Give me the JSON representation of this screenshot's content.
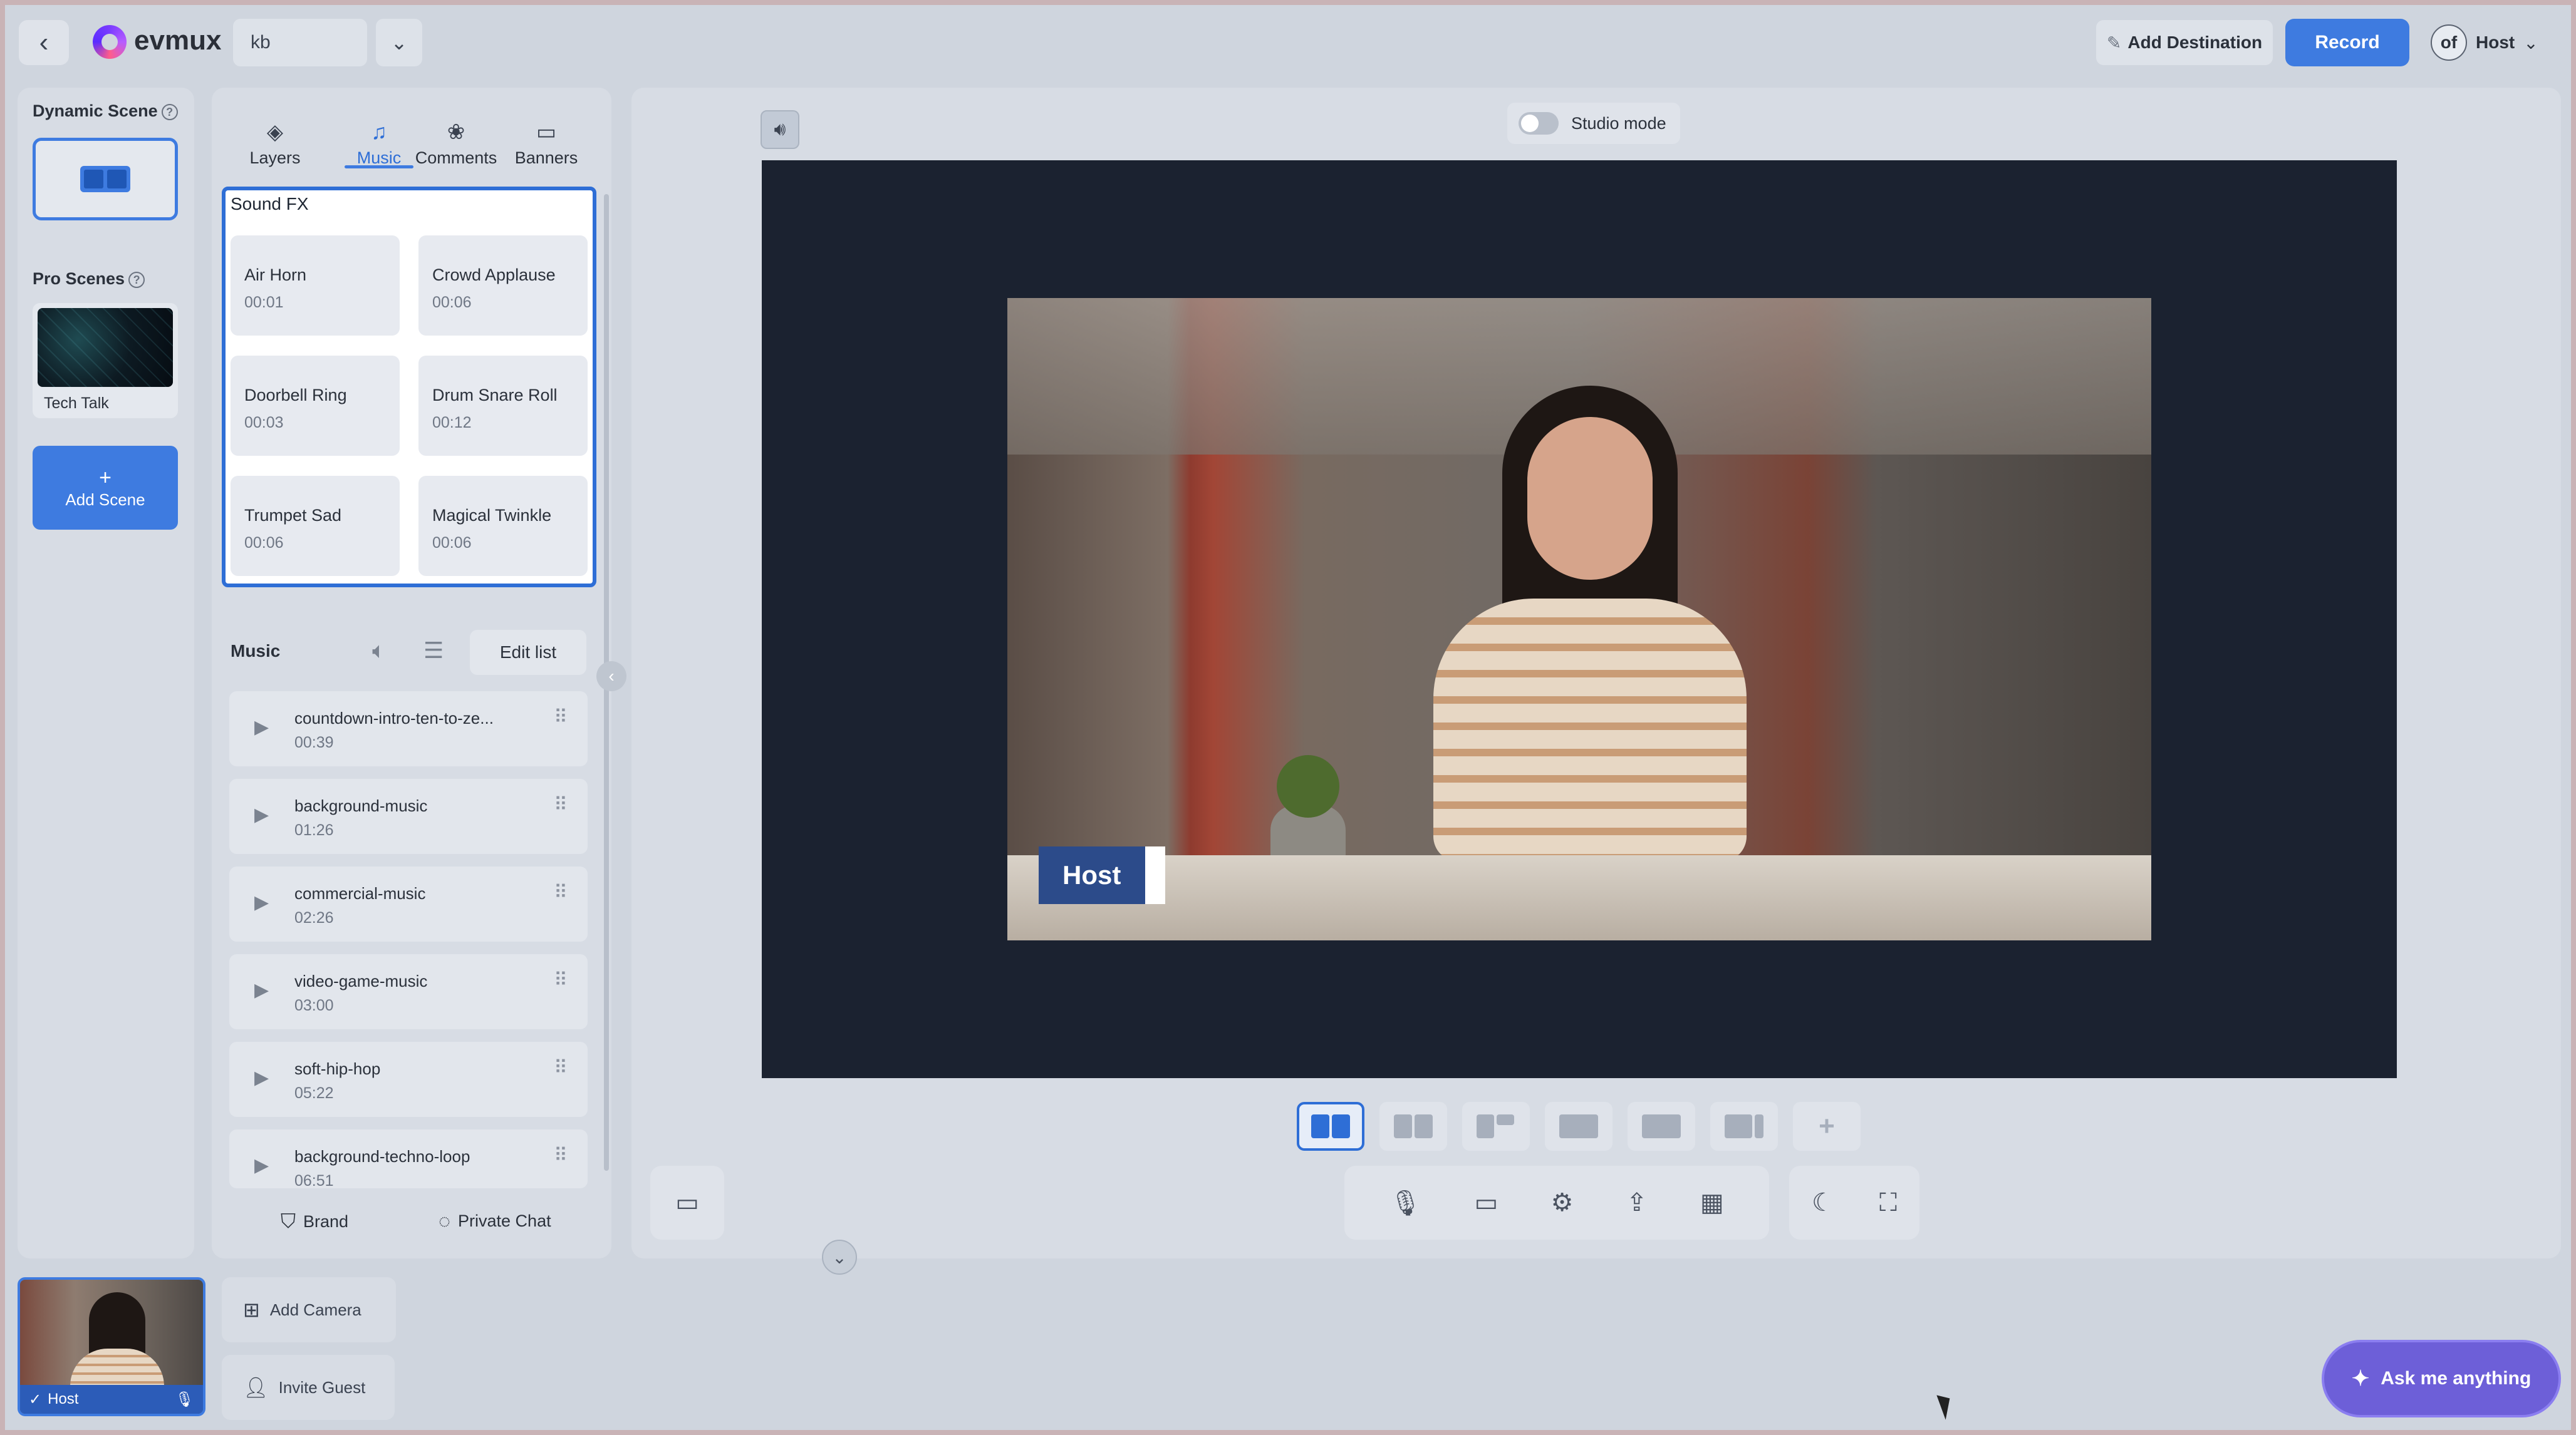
{
  "header": {
    "brand": "evmux",
    "kb": "kb",
    "add_destination": "Add Destination",
    "record": "Record",
    "avatar": "of",
    "host_menu": "Host"
  },
  "scenes": {
    "dynamic_title": "Dynamic Scene",
    "pro_title": "Pro Scenes",
    "pro_item": "Tech Talk",
    "add_scene": "Add Scene"
  },
  "tabs": [
    {
      "label": "Layers",
      "icon": "layers-icon"
    },
    {
      "label": "Music",
      "icon": "music-icon"
    },
    {
      "label": "Comments",
      "icon": "comments-icon"
    },
    {
      "label": "Banners",
      "icon": "banners-icon"
    }
  ],
  "sound_fx": {
    "title": "Sound FX",
    "items": [
      {
        "name": "Air Horn",
        "time": "00:01"
      },
      {
        "name": "Crowd Applause",
        "time": "00:06"
      },
      {
        "name": "Doorbell Ring",
        "time": "00:03"
      },
      {
        "name": "Drum Snare Roll",
        "time": "00:12"
      },
      {
        "name": "Trumpet Sad",
        "time": "00:06"
      },
      {
        "name": "Magical Twinkle",
        "time": "00:06"
      }
    ]
  },
  "music": {
    "title": "Music",
    "edit_list": "Edit list",
    "tracks": [
      {
        "name": "countdown-intro-ten-to-ze...",
        "time": "00:39"
      },
      {
        "name": "background-music",
        "time": "01:26"
      },
      {
        "name": "commercial-music",
        "time": "02:26"
      },
      {
        "name": "video-game-music",
        "time": "03:00"
      },
      {
        "name": "soft-hip-hop",
        "time": "05:22"
      },
      {
        "name": "background-techno-loop",
        "time": "06:51"
      }
    ]
  },
  "panel_footer": {
    "brand": "Brand",
    "private_chat": "Private Chat"
  },
  "stage": {
    "studio_mode": "Studio mode",
    "host_tag": "Host"
  },
  "bottom": {
    "cam_label": "Host",
    "add_camera": "Add Camera",
    "invite_guest": "Invite Guest",
    "ask": "Ask me anything"
  },
  "colors": {
    "accent": "#3e7be0",
    "host_tag": "#2c4b8a",
    "ask": "#6d5fd8"
  }
}
